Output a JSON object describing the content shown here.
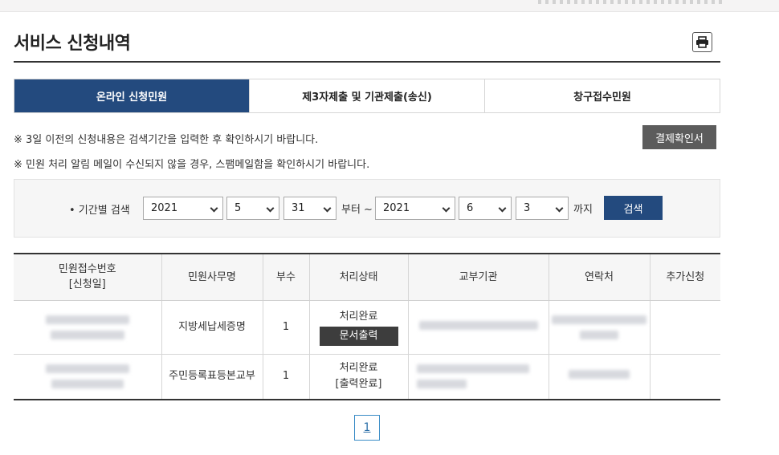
{
  "page": {
    "title": "서비스 신청내역"
  },
  "tabs": [
    {
      "label": "온라인 신청민원",
      "active": true
    },
    {
      "label": "제3자제출 및 기관제출(송신)",
      "active": false
    },
    {
      "label": "창구접수민원",
      "active": false
    }
  ],
  "notices": {
    "line1": "※ 3일 이전의 신청내용은 검색기간을 입력한 후 확인하시기 바랍니다.",
    "line2": "※ 민원 처리 알림 메일이 수신되지 않을 경우, 스팸메일함을 확인하시기 바랍니다."
  },
  "receipt_button": "결제확인서",
  "search": {
    "label": "• 기간별 검색",
    "from": {
      "year": "2021",
      "month": "5",
      "day": "31"
    },
    "from_word": "부터 ~",
    "to": {
      "year": "2021",
      "month": "6",
      "day": "3"
    },
    "to_word": "까지",
    "button": "검색"
  },
  "table": {
    "headers": {
      "receipt_no": "민원접수번호",
      "receipt_date": "[신청일]",
      "service": "민원사무명",
      "copies": "부수",
      "status": "처리상태",
      "agency": "교부기관",
      "contact": "연락처",
      "extra": "추가신청"
    },
    "rows": [
      {
        "service": "지방세납세증명",
        "copies": "1",
        "status": "처리완료",
        "action": "문서출력"
      },
      {
        "service": "주민등록표등본교부",
        "copies": "1",
        "status": "처리완료",
        "action": "[출력완료]"
      }
    ]
  },
  "pagination": {
    "current": "1"
  },
  "colors": {
    "primary": "#234a7e",
    "dark_button": "#5c5c5c",
    "doc_button": "#3d3d3d",
    "pager": "#3a8cc6"
  },
  "icons": {
    "print": "printer-icon"
  }
}
